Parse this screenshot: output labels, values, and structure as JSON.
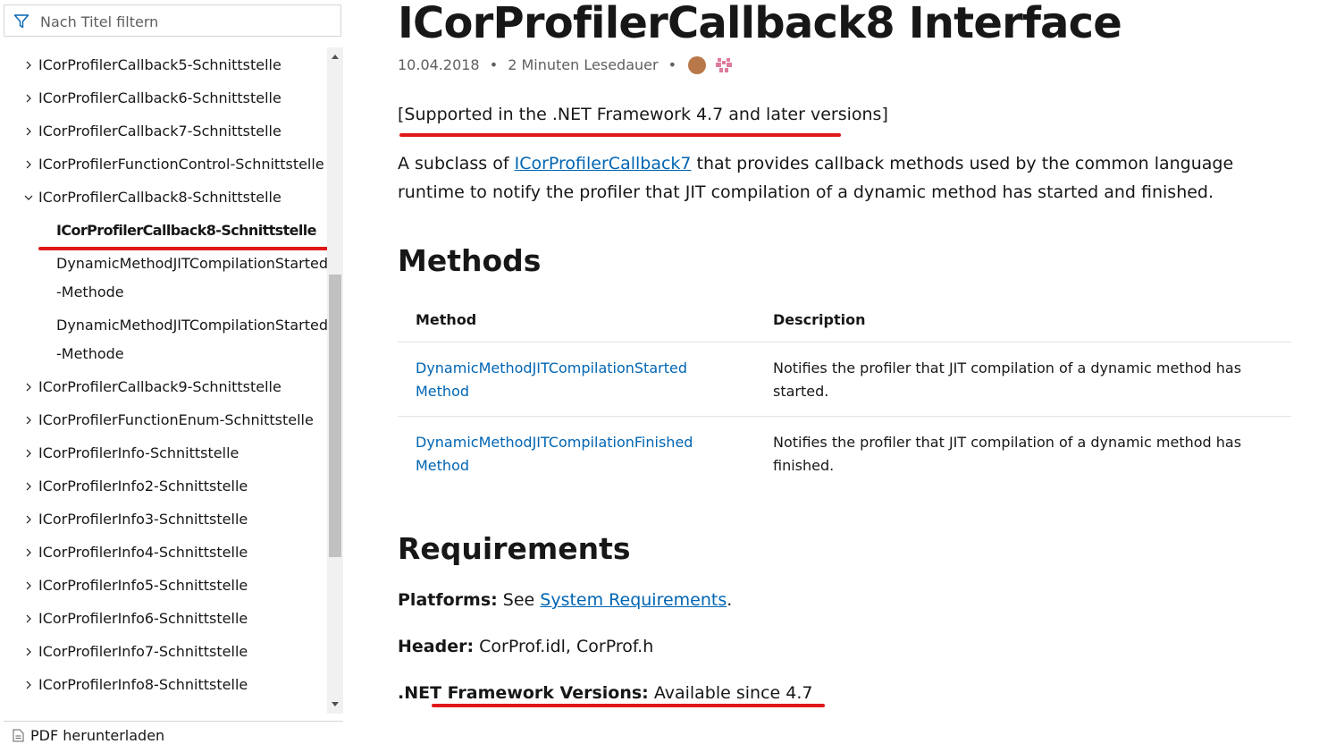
{
  "sidebar": {
    "filter_placeholder": "Nach Titel filtern",
    "items": [
      {
        "label": "ICorProfilerCallback5-Schnittstelle",
        "expanded": false
      },
      {
        "label": "ICorProfilerCallback6-Schnittstelle",
        "expanded": false
      },
      {
        "label": "ICorProfilerCallback7-Schnittstelle",
        "expanded": false
      },
      {
        "label": "ICorProfilerFunctionControl-Schnittstelle",
        "expanded": false
      },
      {
        "label": "ICorProfilerCallback8-Schnittstelle",
        "expanded": true
      },
      {
        "label": "ICorProfilerCallback8-Schnittstelle",
        "selected": true
      },
      {
        "label": "DynamicMethodJITCompilationStarted -Methode"
      },
      {
        "label": "DynamicMethodJITCompilationStarted -Methode"
      },
      {
        "label": "ICorProfilerCallback9-Schnittstelle",
        "expanded": false
      },
      {
        "label": "ICorProfilerFunctionEnum-Schnittstelle",
        "expanded": false
      },
      {
        "label": "ICorProfilerInfo-Schnittstelle",
        "expanded": false
      },
      {
        "label": "ICorProfilerInfo2-Schnittstelle",
        "expanded": false
      },
      {
        "label": "ICorProfilerInfo3-Schnittstelle",
        "expanded": false
      },
      {
        "label": "ICorProfilerInfo4-Schnittstelle",
        "expanded": false
      },
      {
        "label": "ICorProfilerInfo5-Schnittstelle",
        "expanded": false
      },
      {
        "label": "ICorProfilerInfo6-Schnittstelle",
        "expanded": false
      },
      {
        "label": "ICorProfilerInfo7-Schnittstelle",
        "expanded": false
      },
      {
        "label": "ICorProfilerInfo8-Schnittstelle",
        "expanded": false
      }
    ],
    "pdf_label": "PDF herunterladen"
  },
  "article": {
    "title": "ICorProfilerCallback8 Interface",
    "date": "10.04.2018",
    "read_time": "2 Minuten Lesedauer",
    "separator": "•",
    "supported": "[Supported in the .NET Framework 4.7 and later versions]",
    "intro_prefix": "A subclass of ",
    "intro_link": "ICorProfilerCallback7",
    "intro_suffix": " that provides callback methods used by the common language runtime to notify the profiler that JIT compilation of a dynamic method has started and finished.",
    "methods_heading": "Methods",
    "methods_table": {
      "headers": [
        "Method",
        "Description"
      ],
      "rows": [
        {
          "method": "DynamicMethodJITCompilationStarted Method",
          "description": "Notifies the profiler that JIT compilation of a dynamic method has started."
        },
        {
          "method": "DynamicMethodJITCompilationFinished Method",
          "description": "Notifies the profiler that JIT compilation of a dynamic method has finished."
        }
      ]
    },
    "requirements_heading": "Requirements",
    "platforms_label": "Platforms:",
    "platforms_prefix": " See ",
    "platforms_link": "System Requirements",
    "platforms_suffix": ".",
    "header_label": "Header:",
    "header_value": " CorProf.idl, CorProf.h",
    "netfx_label": ".NET Framework Versions:",
    "netfx_value": " Available since 4.7"
  },
  "colors": {
    "link": "#0065b3",
    "annotation_underline": "#e01818",
    "selected_bg": "#f2f2f2"
  }
}
